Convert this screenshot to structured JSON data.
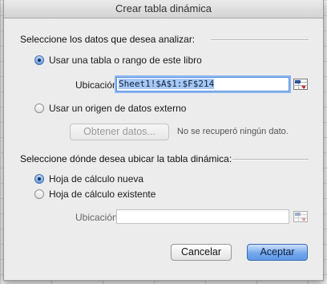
{
  "dialog": {
    "title": "Crear tabla dinámica",
    "source_section": {
      "heading": "Seleccione los datos que desea analizar:",
      "option_table": "Usar una tabla o rango de este libro",
      "location_label": "Ubicación:",
      "location_value": "Sheet1!$A$1:$F$214",
      "option_external": "Usar un origen de datos externo",
      "get_data_button": "Obtener datos...",
      "external_status": "No se recuperó ningún dato."
    },
    "destination_section": {
      "heading": "Seleccione dónde desea ubicar la tabla dinámica:",
      "option_new_sheet": "Hoja de cálculo nueva",
      "option_existing_sheet": "Hoja de cálculo existente",
      "location_label": "Ubicación:",
      "location_value": ""
    },
    "buttons": {
      "cancel": "Cancelar",
      "ok": "Aceptar"
    },
    "selected": {
      "source": "table",
      "destination": "new_sheet"
    }
  },
  "colors": {
    "accent": "#5e98e6",
    "selection": "#a8c9f5",
    "focus_ring": "#8cb6f0"
  },
  "icons": {
    "range_picker": "collapse-range-icon",
    "radio": "radio-icon"
  }
}
